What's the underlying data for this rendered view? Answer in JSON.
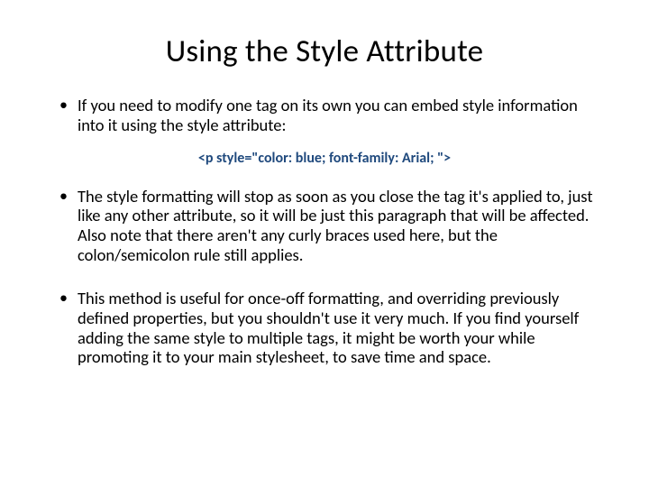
{
  "slide": {
    "title": "Using the Style Attribute",
    "bullets": [
      "If you need to modify one tag on its own you can embed style information into it using the style attribute:",
      "The style formatting will stop as soon as you close the tag it's applied to, just like any other attribute, so it will be just this paragraph that will be affected. Also note that there aren't any curly braces used here, but the colon/semicolon rule still applies.",
      "This method is useful for once-off formatting, and overriding previously defined properties, but you shouldn't use it very much. If you find yourself adding the same style to multiple tags, it might be worth your while promoting it to your main stylesheet, to save time and space."
    ],
    "code_example": "<p style=\"color: blue; font-family: Arial; \">"
  }
}
